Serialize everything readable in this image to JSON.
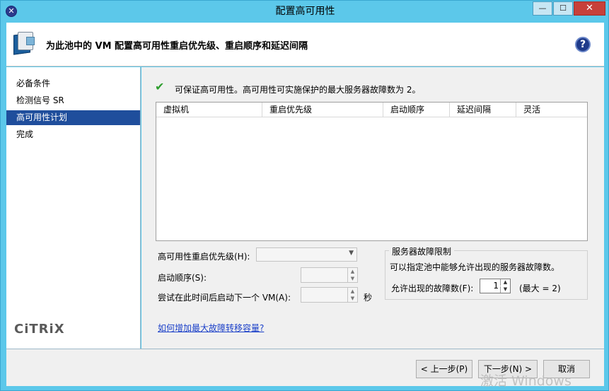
{
  "window": {
    "title": "配置高可用性",
    "app_icon": "x-circle-icon",
    "min_glyph": "—",
    "max_glyph": "☐",
    "close_glyph": "✕"
  },
  "header": {
    "title": "为此池中的 VM 配置高可用性重启优先级、重启顺序和延迟间隔",
    "help_glyph": "?"
  },
  "nav": {
    "items": [
      {
        "label": "必备条件"
      },
      {
        "label": "检测信号 SR"
      },
      {
        "label": "高可用性计划",
        "active": true
      },
      {
        "label": "完成"
      }
    ],
    "logo": "CiTRiX"
  },
  "main": {
    "status_text": "可保证高可用性。高可用性可实施保护的最大服务器故障数为 2。",
    "table": {
      "columns": [
        "虚拟机",
        "重启优先级",
        "启动顺序",
        "延迟间隔",
        "灵活"
      ],
      "rows": []
    },
    "priority_label": "高可用性重启优先级(H):",
    "order_label": "启动顺序(S):",
    "delay_label": "尝试在此时间后启动下一个 VM(A):",
    "delay_unit": "秒",
    "group": {
      "title": "服务器故障限制",
      "desc": "可以指定池中能够允许出现的服务器故障数。",
      "fail_label": "允许出现的故障数(F):",
      "fail_value": "1",
      "fail_max": "(最大 = 2)"
    },
    "help_link": "如何增加最大故障转移容量?"
  },
  "footer": {
    "back": "< 上一步(P)",
    "next": "下一步(N) >",
    "cancel": "取消",
    "watermark": "激活 Windows"
  }
}
